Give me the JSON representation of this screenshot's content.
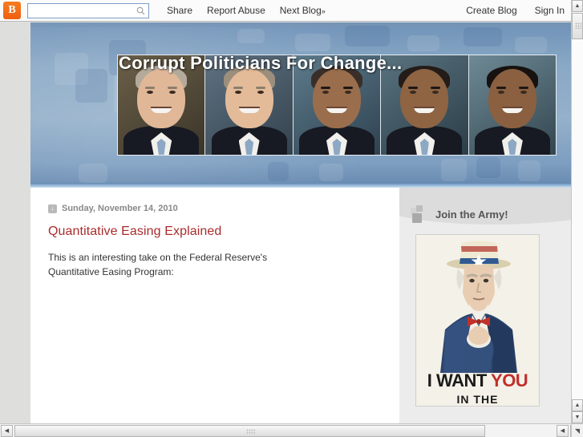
{
  "navbar": {
    "logo_letter": "B",
    "logo_name": "blogger-logo",
    "search_placeholder": "",
    "search_value": "",
    "search_icon": "search-icon",
    "links": [
      {
        "label": "Share"
      },
      {
        "label": "Report Abuse"
      },
      {
        "label": "Next Blog",
        "suffix": "»"
      }
    ],
    "right_links": [
      {
        "label": "Create Blog"
      },
      {
        "label": "Sign In"
      }
    ]
  },
  "header": {
    "title": "Corrupt Politicians For Change...",
    "portraits": [
      {
        "name": "portrait-bush-1"
      },
      {
        "name": "portrait-bush-2"
      },
      {
        "name": "portrait-morph-3"
      },
      {
        "name": "portrait-obama-4"
      },
      {
        "name": "portrait-obama-5"
      }
    ],
    "bg_color": "#8aa9c6",
    "accent_color": "#5d84ad"
  },
  "post": {
    "date_icon": "calendar-down-arrow-icon",
    "date_icon_glyph": "↓",
    "date": "Sunday, November 14, 2010",
    "title": "Quantitative Easing Explained",
    "title_color": "#aa2b2b",
    "body": "This is an interesting take on the Federal Reserve's Quantitative Easing Program:"
  },
  "sidebar": {
    "widget_icon": "squares-icon",
    "widget_title": "Join the Army!",
    "poster": {
      "name": "uncle-sam-poster",
      "main_text_1": "I WANT ",
      "main_text_2": "YOU",
      "sub_text": "IN THE",
      "you_color": "#c0302b"
    }
  },
  "scrollbars": {
    "v_up": "▲",
    "v_down": "▼",
    "h_left": "◀",
    "h_right": "▶",
    "corner_glyph": "◥"
  }
}
